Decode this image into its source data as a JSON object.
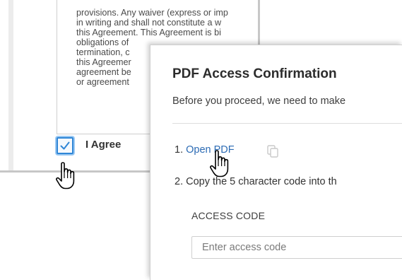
{
  "agreement": {
    "text_lines": [
      "provisions. Any waiver (express or imp",
      "in writing and shall not constitute a w",
      "this Agreement. This Agreement is bi",
      "obligations of",
      "termination, c",
      "this Agreemer",
      "agreement be",
      "or agreement"
    ],
    "checkbox_checked": true,
    "checkbox_label": "I Agree"
  },
  "dialog": {
    "title": "PDF Access Confirmation",
    "subtitle": "Before you proceed, we need to make",
    "step1_prefix": "1. ",
    "step1_link": "Open PDF",
    "step2": "2. Copy the 5 character code into th",
    "access_code_label": "ACCESS CODE",
    "access_code_placeholder": "Enter access code",
    "access_code_value": ""
  },
  "icons": {
    "checkbox": "checkmark-icon",
    "copy": "copy-icon",
    "cursor": "hand-pointer-icon"
  },
  "colors": {
    "accent": "#2f86d6",
    "link": "#2c6bb4"
  }
}
